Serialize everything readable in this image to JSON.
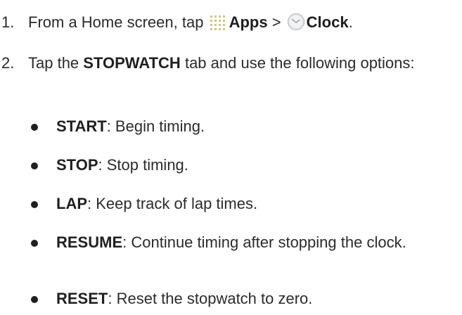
{
  "steps": [
    {
      "number": "1.",
      "pre": "From a Home screen, tap",
      "apps_label": "Apps",
      "separator": ">",
      "clock_label": "Clock",
      "end": ".",
      "icons": [
        "apps-grid-icon",
        "clock-icon"
      ]
    },
    {
      "number": "2.",
      "pre": "Tap the",
      "tab_label": "STOPWATCH",
      "post": "tab and use the following options:"
    }
  ],
  "options": [
    {
      "name": "START",
      "desc": ": Begin timing."
    },
    {
      "name": "STOP",
      "desc": ": Stop timing."
    },
    {
      "name": "LAP",
      "desc": ": Keep track of lap times."
    },
    {
      "name": "RESUME",
      "desc": ": Continue timing after stopping the clock."
    },
    {
      "name": "RESET",
      "desc": ": Reset the stopwatch to zero."
    }
  ],
  "colors": {
    "text": "#2b2b2b",
    "icon_dots": "#c9c97a",
    "clock_face": "#e6e6e6",
    "clock_border": "#bdbdbd",
    "clock_hands": "#8aa0b4"
  }
}
